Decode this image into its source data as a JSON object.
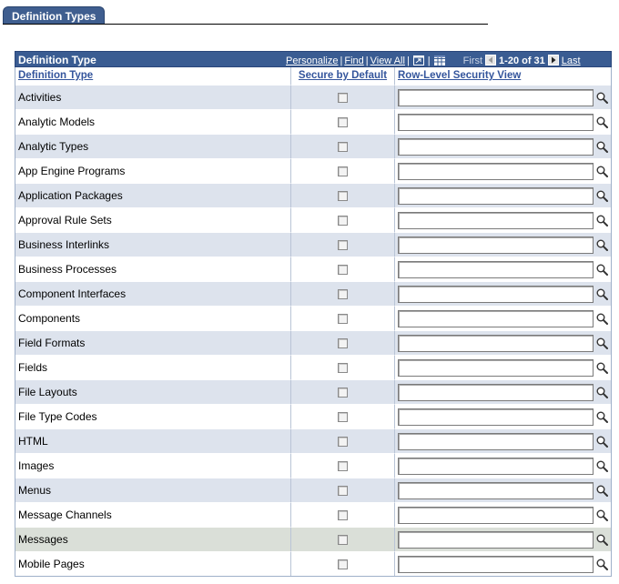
{
  "tab": {
    "label": "Definition Types"
  },
  "grid": {
    "title": "Definition Type",
    "nav": {
      "personalize": "Personalize",
      "find": "Find",
      "view_all": "View All",
      "first": "First",
      "count": "1-20 of 31",
      "last": "Last"
    },
    "columns": {
      "definition_type": "Definition Type",
      "secure_by_default": "Secure by Default",
      "row_level_security_view": "Row-Level Security View"
    },
    "rows": [
      {
        "name": "Activities",
        "secure": false,
        "view": ""
      },
      {
        "name": "Analytic Models",
        "secure": false,
        "view": ""
      },
      {
        "name": "Analytic Types",
        "secure": false,
        "view": ""
      },
      {
        "name": "App Engine Programs",
        "secure": false,
        "view": ""
      },
      {
        "name": "Application Packages",
        "secure": false,
        "view": ""
      },
      {
        "name": "Approval Rule Sets",
        "secure": false,
        "view": ""
      },
      {
        "name": "Business Interlinks",
        "secure": false,
        "view": ""
      },
      {
        "name": "Business Processes",
        "secure": false,
        "view": ""
      },
      {
        "name": "Component Interfaces",
        "secure": false,
        "view": ""
      },
      {
        "name": "Components",
        "secure": false,
        "view": ""
      },
      {
        "name": "Field Formats",
        "secure": false,
        "view": ""
      },
      {
        "name": "Fields",
        "secure": false,
        "view": ""
      },
      {
        "name": "File Layouts",
        "secure": false,
        "view": ""
      },
      {
        "name": "File Type Codes",
        "secure": false,
        "view": ""
      },
      {
        "name": "HTML",
        "secure": false,
        "view": ""
      },
      {
        "name": "Images",
        "secure": false,
        "view": ""
      },
      {
        "name": "Menus",
        "secure": false,
        "view": ""
      },
      {
        "name": "Message Channels",
        "secure": false,
        "view": ""
      },
      {
        "name": "Messages",
        "secure": false,
        "view": "",
        "highlighted": true
      },
      {
        "name": "Mobile Pages",
        "secure": false,
        "view": ""
      }
    ]
  },
  "colors": {
    "tab_bg": "#3f5e8f",
    "grid_header_bg": "#3a5c92",
    "column_link": "#34559c",
    "row_odd": "#dde3ed",
    "row_even": "#ffffff",
    "row_highlight": "#dadfd8"
  }
}
